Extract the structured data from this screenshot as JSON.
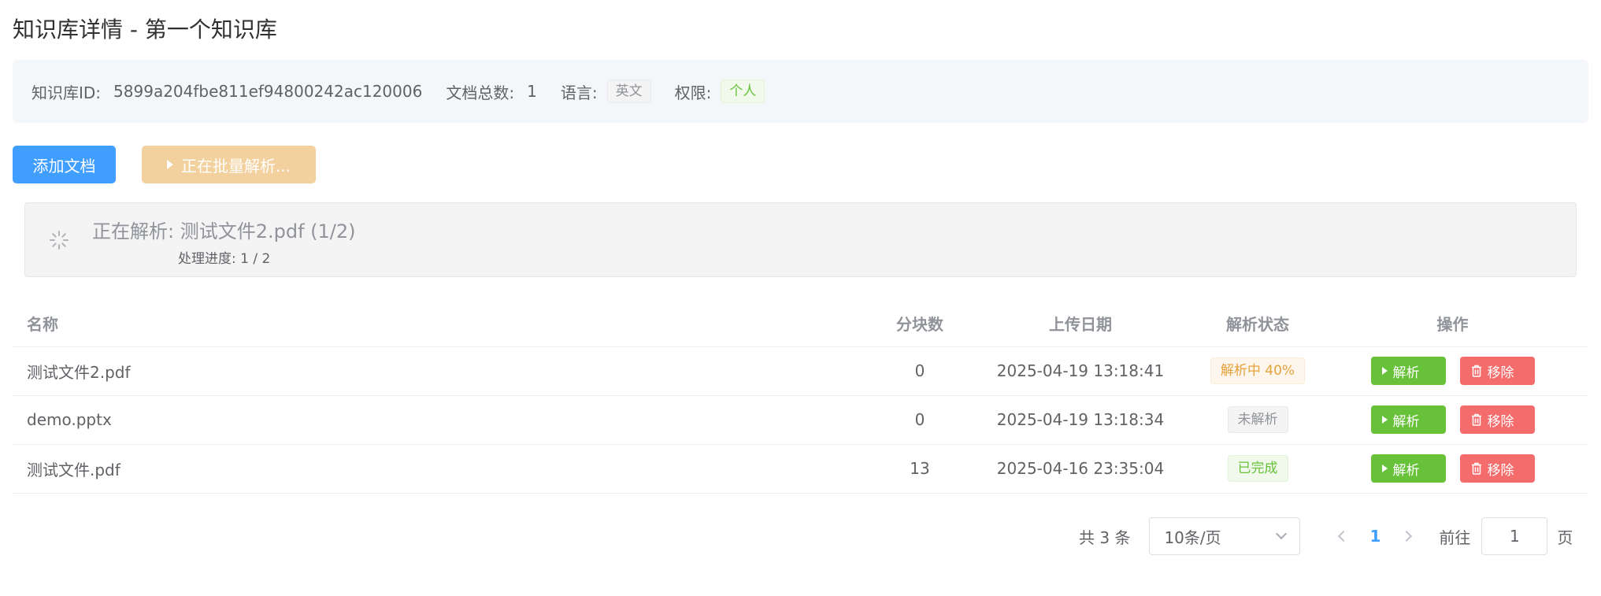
{
  "title": "知识库详情 - 第一个知识库",
  "info": {
    "id_label": "知识库ID:",
    "id_value": "5899a204fbe811ef94800242ac120006",
    "doc_count_label": "文档总数:",
    "doc_count_value": "1",
    "language_label": "语言:",
    "language_value": "英文",
    "permission_label": "权限:",
    "permission_value": "个人"
  },
  "toolbar": {
    "add_label": "添加文档",
    "batch_label": "正在批量解析..."
  },
  "progress": {
    "title": "正在解析: 测试文件2.pdf (1/2)",
    "detail": "处理进度: 1 / 2"
  },
  "table": {
    "headers": {
      "name": "名称",
      "chunks": "分块数",
      "date": "上传日期",
      "status": "解析状态",
      "ops": "操作"
    },
    "rows": [
      {
        "name": "测试文件2.pdf",
        "chunks": "0",
        "date": "2025-04-19 13:18:41",
        "status": "解析中 40%",
        "status_kind": "warning"
      },
      {
        "name": "demo.pptx",
        "chunks": "0",
        "date": "2025-04-19 13:18:34",
        "status": "未解析",
        "status_kind": "info"
      },
      {
        "name": "测试文件.pdf",
        "chunks": "13",
        "date": "2025-04-16 23:35:04",
        "status": "已完成",
        "status_kind": "success"
      }
    ],
    "parse_label": "解析",
    "remove_label": "移除"
  },
  "pagination": {
    "total": "共 3 条",
    "page_size": "10条/页",
    "current_page": "1",
    "goto_label": "前往",
    "goto_value": "1",
    "page_suffix": "页"
  },
  "colors": {
    "primary": "#409eff",
    "success": "#67c23a",
    "danger": "#f56c6c",
    "warning": "#e6a23c"
  }
}
